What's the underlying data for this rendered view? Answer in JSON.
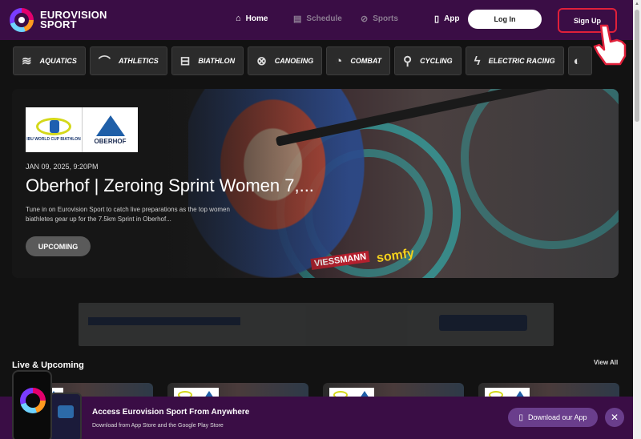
{
  "header": {
    "logo_line1": "EUROVISION",
    "logo_line2": "SPORT",
    "nav": [
      {
        "label": "Home",
        "icon": "home-icon"
      },
      {
        "label": "Schedule",
        "icon": "calendar-icon"
      },
      {
        "label": "Sports",
        "icon": "sports-icon"
      },
      {
        "label": "App",
        "icon": "phone-icon"
      }
    ],
    "login_label": "Log In",
    "signup_label": "Sign Up"
  },
  "sports": [
    {
      "label": "AQUATICS",
      "icon": "waves-icon"
    },
    {
      "label": "ATHLETICS",
      "icon": "shoe-icon"
    },
    {
      "label": "BIATHLON",
      "icon": "rifle-icon"
    },
    {
      "label": "CANOEING",
      "icon": "canoe-icon"
    },
    {
      "label": "COMBAT",
      "icon": "glove-icon"
    },
    {
      "label": "CYCLING",
      "icon": "bicycle-icon"
    },
    {
      "label": "ELECTRIC RACING",
      "icon": "bolt-icon"
    }
  ],
  "hero": {
    "date": "JAN 09, 2025, 9:20PM",
    "title": "Oberhof | Zeroing Sprint Women 7,...",
    "description": "Tune in on Eurovision Sport to catch live preparations as the top women biathletes gear up for the 7.5km Sprint in Oberhof...",
    "button_label": "UPCOMING",
    "logo_worldcup": "IBU WORLD CUP BIATHLON",
    "logo_oberhof": "OBERHOF",
    "brand1": "VIESSMANN",
    "brand2": "somfy"
  },
  "live": {
    "section_title": "Live & Upcoming",
    "view_all": "View All"
  },
  "app_banner": {
    "title": "Access Eurovision Sport From Anywhere",
    "subtitle": "Download from App Store and the Google Play Store",
    "download_label": "Download our App",
    "close_symbol": "✕"
  },
  "colors": {
    "header_bg": "#3a0d45",
    "page_bg": "#121212",
    "signup_outline": "#e0203a",
    "button_purple": "#6a3e8c"
  }
}
